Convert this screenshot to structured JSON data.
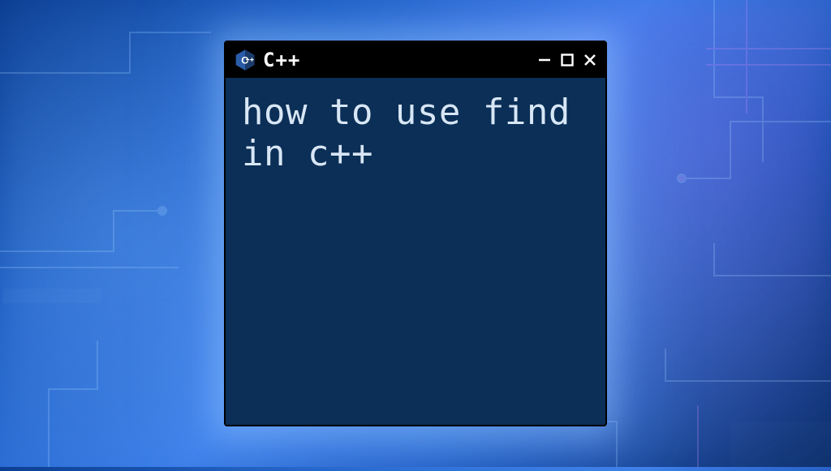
{
  "window": {
    "title": "C++",
    "icon": "cpp-icon",
    "content": "how to use find in c++"
  },
  "colors": {
    "window_bg": "#0b2f56",
    "titlebar_bg": "#000000",
    "text": "#d8e6f5",
    "icon_primary": "#2a5ca8",
    "icon_dark": "#1a3a6a"
  }
}
